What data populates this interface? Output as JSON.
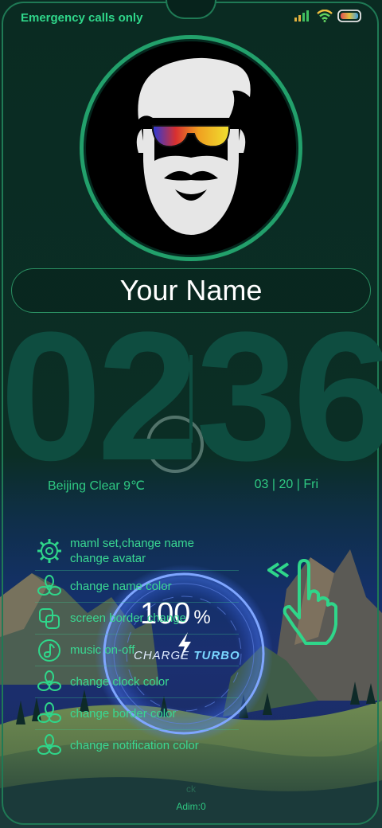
{
  "status_bar": {
    "carrier_text": "Emergency calls only",
    "icons": [
      "signal-icon",
      "wifi-icon",
      "battery-icon"
    ]
  },
  "profile": {
    "name": "Your Name",
    "avatar": "bearded-man-sunglasses-avatar"
  },
  "clock": {
    "hours": "02",
    "minutes": "36"
  },
  "weather": "Beijing Clear 9℃",
  "date": "03 | 20 | Fri",
  "menu": {
    "first_line1": "maml set,change name",
    "first_line2": "change avatar",
    "items": [
      {
        "label": "change name color",
        "icon": "flower-icon"
      },
      {
        "label": "screen border change",
        "icon": "squares-icon"
      },
      {
        "label": "music on-off",
        "icon": "music-icon"
      },
      {
        "label": "change clock color",
        "icon": "flower-icon"
      },
      {
        "label": "change border color",
        "icon": "flower-icon"
      },
      {
        "label": "change notification color",
        "icon": "flower-icon"
      }
    ]
  },
  "charge": {
    "percent": "100",
    "percent_sign": "%",
    "label_a": "CHARGE",
    "label_b": "TURBO"
  },
  "bottom": {
    "line1": "ck",
    "line2": "Adim:0"
  },
  "colors": {
    "accent": "#2fd68a",
    "clock_digits": "#0e4d40",
    "border": "#1f7a55"
  }
}
